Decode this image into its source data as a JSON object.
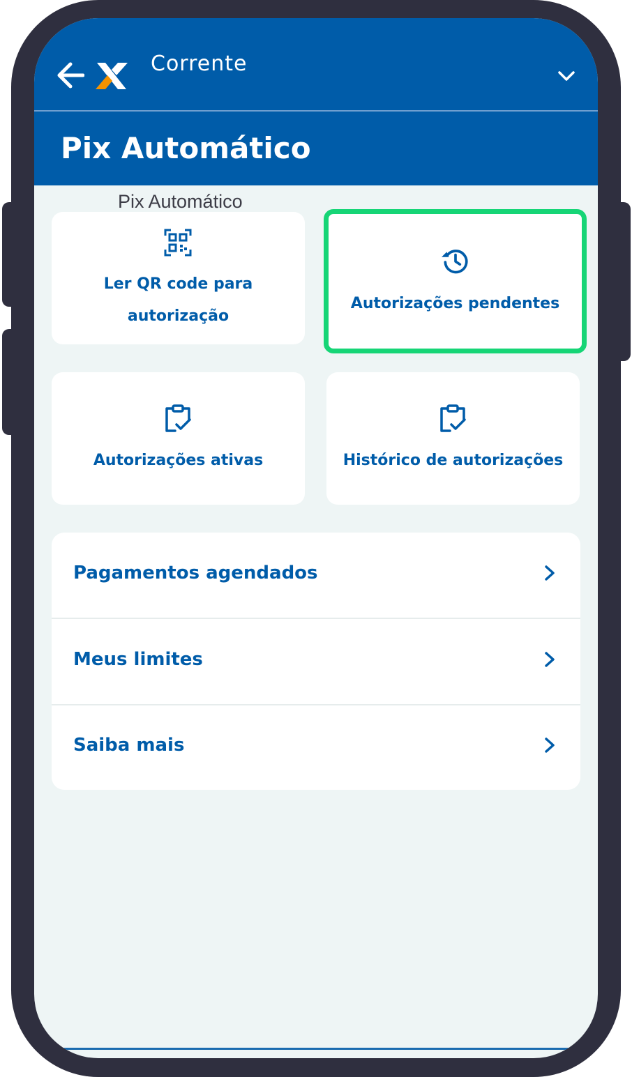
{
  "header": {
    "account_label": "Corrente",
    "page_title": "Pix Automático"
  },
  "section": {
    "label": "Pix Automático"
  },
  "cards": [
    {
      "line1": "Ler QR code para",
      "line2": "autorização",
      "icon": "qr-code-icon"
    },
    {
      "label": "Autorizações pendentes",
      "icon": "history-icon",
      "highlighted": true
    },
    {
      "label": "Autorizações ativas",
      "icon": "clipboard-check-icon"
    },
    {
      "label": "Histórico de autorizações",
      "icon": "clipboard-check-icon"
    }
  ],
  "menu": [
    {
      "label": "Pagamentos agendados"
    },
    {
      "label": "Meus limites"
    },
    {
      "label": "Saiba mais"
    }
  ],
  "colors": {
    "brand_blue": "#005ca9",
    "highlight_green": "#16d576",
    "logo_orange": "#f39200",
    "frame": "#2f2f3f",
    "background": "#eef5f5"
  }
}
